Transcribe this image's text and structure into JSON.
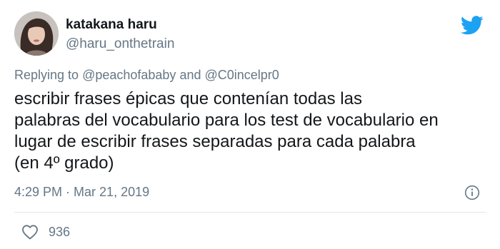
{
  "user": {
    "display_name": "katakana haru",
    "handle": "@haru_onthetrain"
  },
  "reply": {
    "prefix": "Replying to ",
    "mention_1": "@peachofababy",
    "connector": " and ",
    "mention_2": "@C0incelpr0"
  },
  "tweet": {
    "line_1": "escribir frases épicas que contenían todas las",
    "line_2": "palabras del vocabulario para los test de vocabulario en",
    "line_3": "lugar de escribir frases separadas para cada palabra",
    "line_4": "(en 4º grado)"
  },
  "meta": {
    "time": "4:29 PM",
    "separator": " · ",
    "date": "Mar 21, 2019"
  },
  "engagement": {
    "likes": "936"
  },
  "icons": {
    "brand": "twitter-bird-icon",
    "info": "info-icon",
    "like": "heart-icon"
  },
  "colors": {
    "brand": "#1da1f2",
    "secondary_text": "#657786",
    "primary_text": "#14171a",
    "divider": "#e1e8ed"
  }
}
